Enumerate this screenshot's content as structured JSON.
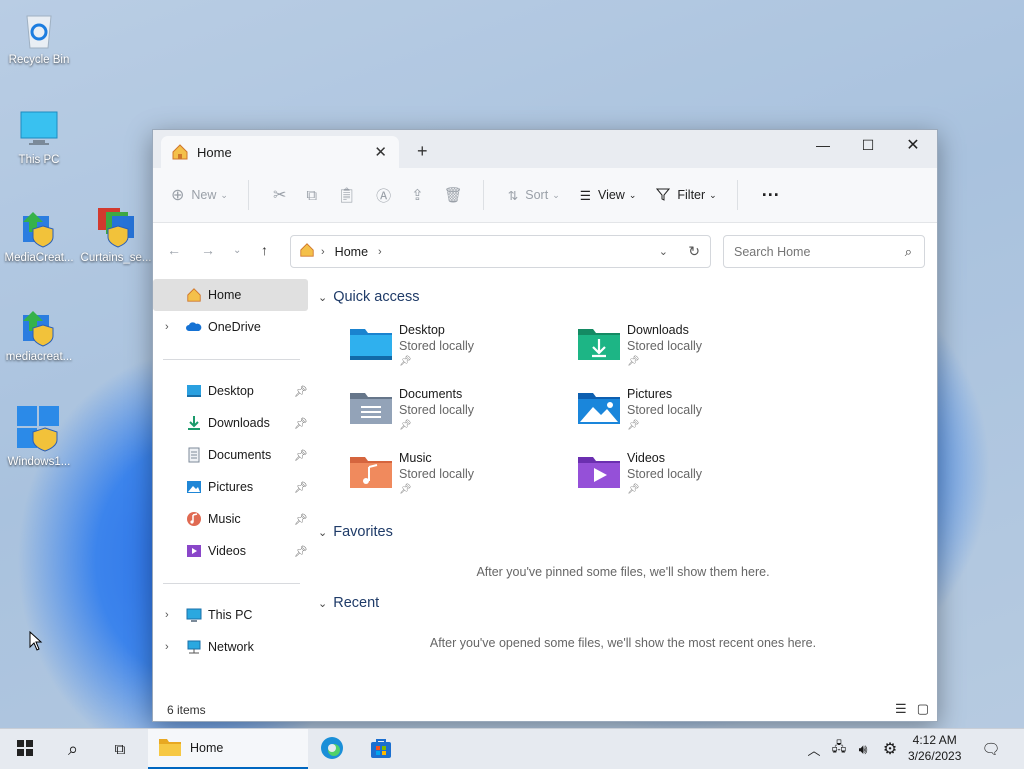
{
  "desktop": {
    "icons": [
      {
        "label": "Recycle Bin"
      },
      {
        "label": "This PC"
      },
      {
        "label": "MediaCreat..."
      },
      {
        "label": "Curtains_se..."
      },
      {
        "label": "mediacreat..."
      },
      {
        "label": "Windows1..."
      }
    ]
  },
  "window": {
    "tab_title": "Home",
    "toolbar": {
      "new_label": "New",
      "sort_label": "Sort",
      "view_label": "View",
      "filter_label": "Filter",
      "more_label": "···"
    },
    "address": {
      "segment": "Home"
    },
    "search": {
      "placeholder": "Search Home"
    },
    "nav": {
      "home": "Home",
      "onedrive": "OneDrive",
      "pinned": [
        {
          "label": "Desktop"
        },
        {
          "label": "Downloads"
        },
        {
          "label": "Documents"
        },
        {
          "label": "Pictures"
        },
        {
          "label": "Music"
        },
        {
          "label": "Videos"
        }
      ],
      "thispc": "This PC",
      "network": "Network"
    },
    "quick_access": {
      "title": "Quick access",
      "items": [
        {
          "name": "Desktop",
          "sub": "Stored locally"
        },
        {
          "name": "Downloads",
          "sub": "Stored locally"
        },
        {
          "name": "Documents",
          "sub": "Stored locally"
        },
        {
          "name": "Pictures",
          "sub": "Stored locally"
        },
        {
          "name": "Music",
          "sub": "Stored locally"
        },
        {
          "name": "Videos",
          "sub": "Stored locally"
        }
      ]
    },
    "favorites": {
      "title": "Favorites",
      "empty": "After you've pinned some files, we'll show them here."
    },
    "recent": {
      "title": "Recent",
      "empty": "After you've opened some files, we'll show the most recent ones here."
    },
    "status": "6 items"
  },
  "taskbar": {
    "explorer_label": "Home",
    "time": "4:12 AM",
    "date": "3/26/2023"
  },
  "colors": {
    "accent": "#0067c0",
    "folder_yellow": "#f3c242"
  }
}
